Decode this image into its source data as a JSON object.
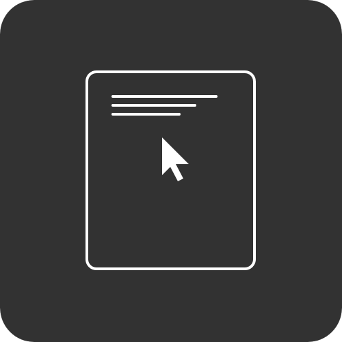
{
  "app_icon": {
    "icon": "document-with-cursor-icon",
    "colors": {
      "background": "#323232",
      "foreground": "#ffffff"
    },
    "document": {
      "icon": "document-page-icon",
      "text_line_count": 3
    },
    "cursor": {
      "icon": "mouse-pointer-icon"
    }
  }
}
